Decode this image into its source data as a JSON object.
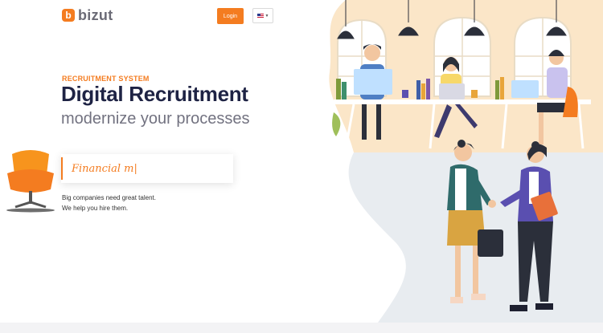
{
  "header": {
    "brand_name": "bizut",
    "brand_mark": "b",
    "login_label": "Login",
    "language": "en-US",
    "language_flag_icon": "us-flag-icon",
    "accent_color": "#f47c20"
  },
  "hero": {
    "eyebrow": "RECRUITMENT SYSTEM",
    "headline": "Digital Recruitment",
    "subhead": "modernize your processes",
    "typing_text": "Financial m|",
    "description_line1": "Big companies need great talent.",
    "description_line2": "We help you hire them."
  }
}
